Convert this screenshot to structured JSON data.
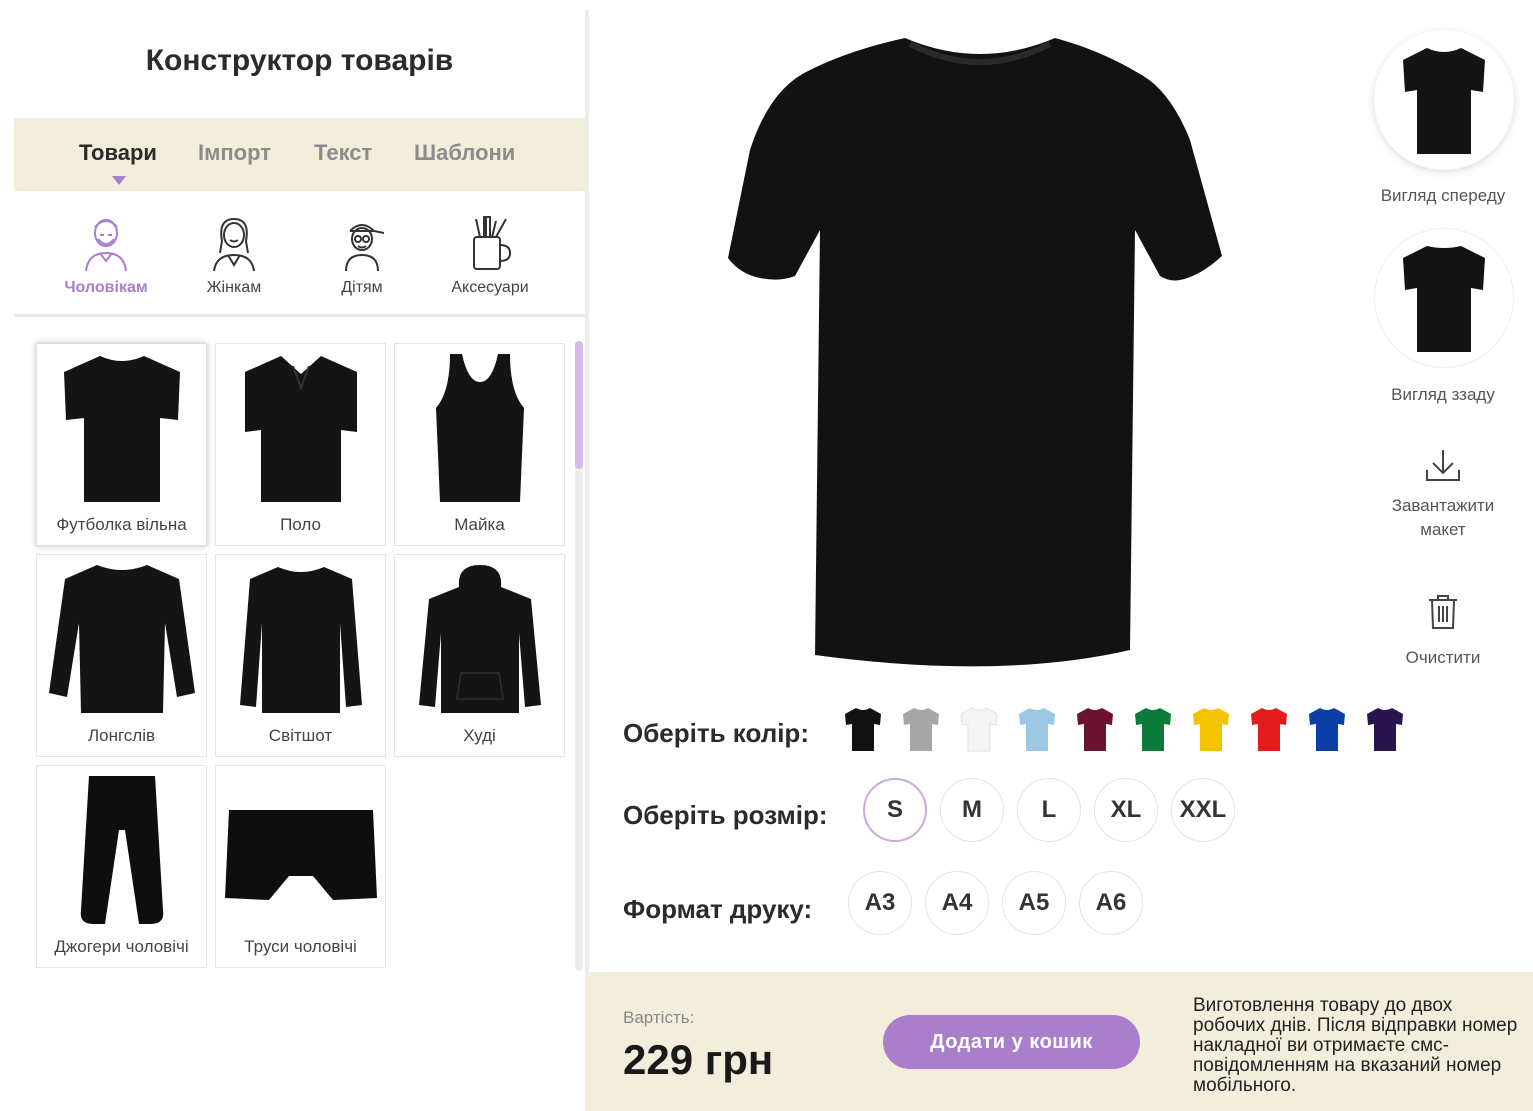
{
  "panel": {
    "title": "Конструктор товарів",
    "tabs": [
      {
        "label": "Товари",
        "active": true
      },
      {
        "label": "Імпорт",
        "active": false
      },
      {
        "label": "Текст",
        "active": false
      },
      {
        "label": "Шаблони",
        "active": false
      }
    ],
    "categories": [
      {
        "label": "Чоловікам",
        "icon": "man-icon",
        "active": true
      },
      {
        "label": "Жінкам",
        "icon": "woman-icon",
        "active": false
      },
      {
        "label": "Дітям",
        "icon": "child-icon",
        "active": false
      },
      {
        "label": "Аксесуари",
        "icon": "accessories-icon",
        "active": false
      }
    ],
    "products": [
      {
        "label": "Футболка вільна",
        "icon": "tshirt-icon",
        "selected": true
      },
      {
        "label": "Поло",
        "icon": "polo-icon",
        "selected": false
      },
      {
        "label": "Майка",
        "icon": "tank-top-icon",
        "selected": false
      },
      {
        "label": "Лонгслів",
        "icon": "longsleeve-icon",
        "selected": false
      },
      {
        "label": "Світшот",
        "icon": "sweatshirt-icon",
        "selected": false
      },
      {
        "label": "Худі",
        "icon": "hoodie-icon",
        "selected": false
      },
      {
        "label": "Джогери чоловічі",
        "icon": "joggers-icon",
        "selected": false
      },
      {
        "label": "Труси чоловічі",
        "icon": "boxers-icon",
        "selected": false
      }
    ]
  },
  "preview": {
    "icon": "tshirt-preview"
  },
  "side": {
    "front_label": "Вигляд спереду",
    "back_label": "Вигляд ззаду",
    "download_label_1": "Завантажити",
    "download_label_2": "макет",
    "clear_label": "Очистити"
  },
  "options": {
    "color_label": "Оберіть колір:",
    "colors": [
      "#111111",
      "#a6a6a6",
      "#f4f4f4",
      "#9cc7e2",
      "#6b1230",
      "#0c7a3a",
      "#f5c400",
      "#e31b1b",
      "#0b3fa6",
      "#2a1450"
    ],
    "selected_color": "#111111",
    "size_label": "Оберіть розмір:",
    "sizes": [
      "S",
      "M",
      "L",
      "XL",
      "XXL"
    ],
    "selected_size": "S",
    "format_label": "Формат друку:",
    "formats": [
      "A3",
      "A4",
      "A5",
      "A6"
    ]
  },
  "footer": {
    "price_label": "Вартість:",
    "price": "229 грн",
    "add_button": "Додати у кошик",
    "note": "Виготовлення товару до двох робочих днів. Після відправки номер накладної ви отримаєте смс-повідомленням на вказаний номер мобільного."
  },
  "colors": {
    "accent": "#a97fcc",
    "beige": "#f3eddb"
  }
}
